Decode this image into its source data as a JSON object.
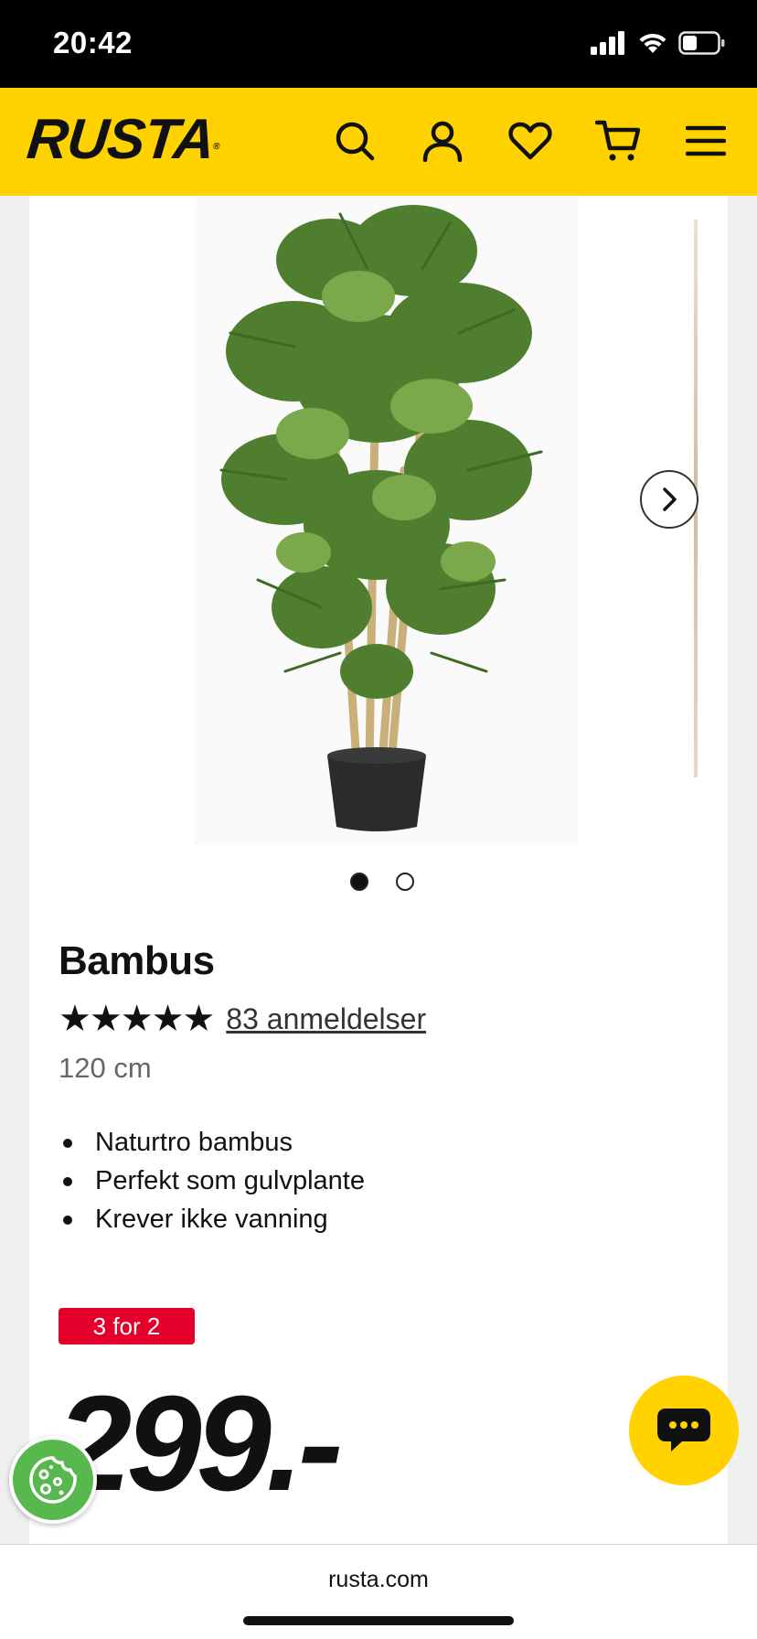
{
  "status_bar": {
    "time": "20:42"
  },
  "header": {
    "logo": "RUSTA",
    "logo_mark": "®",
    "icons": [
      "search-icon",
      "account-icon",
      "wishlist-heart-icon",
      "cart-icon",
      "menu-icon"
    ],
    "brand_color": "#ffd200"
  },
  "gallery": {
    "slide_count": 2,
    "active_slide": 1
  },
  "product": {
    "title": "Bambus",
    "rating": 5,
    "stars_text": "★★★★★",
    "reviews_label": "83 anmeldelser",
    "size": "120 cm",
    "features": [
      "Naturtro bambus",
      "Perfekt som gulvplante",
      "Krever ikke vanning"
    ],
    "promo_badge": "3 for 2",
    "promo_color": "#e4002b",
    "price": "299.-"
  },
  "browser": {
    "url": "rusta.com"
  }
}
